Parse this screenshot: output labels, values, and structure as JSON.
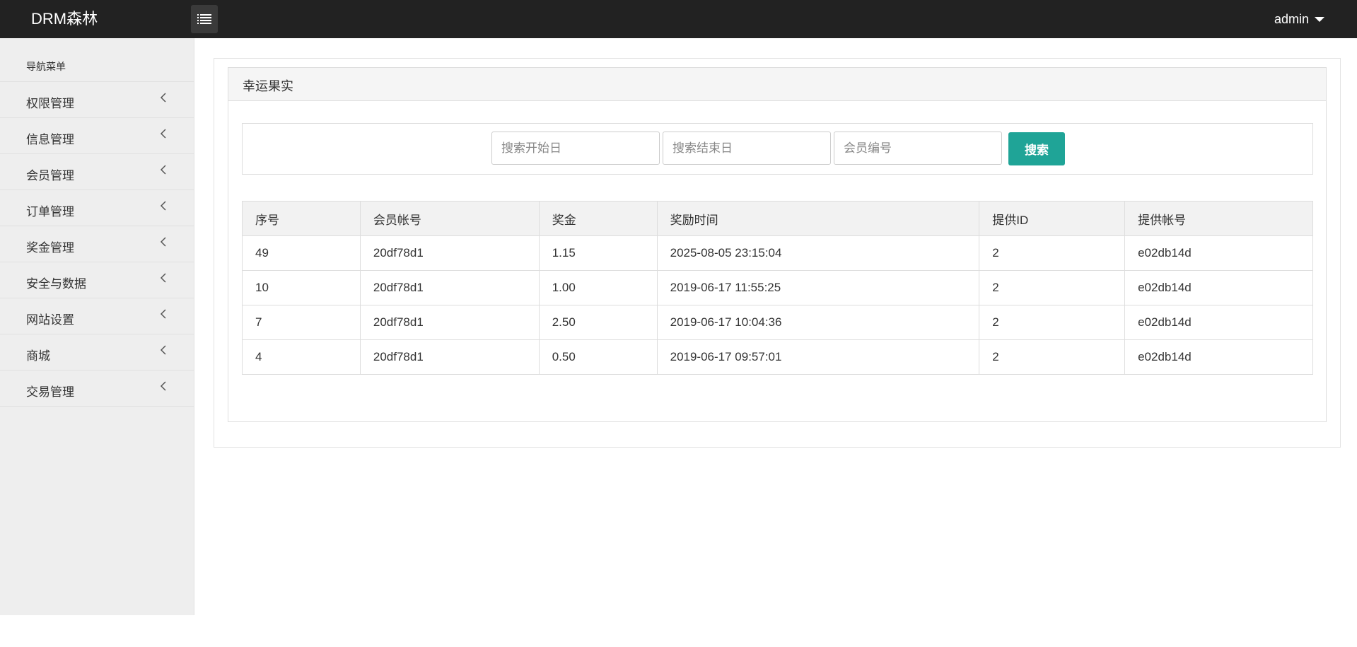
{
  "header": {
    "brand": "DRM森林",
    "user": "admin"
  },
  "sidebar": {
    "title": "导航菜单",
    "items": [
      {
        "label": "权限管理"
      },
      {
        "label": "信息管理"
      },
      {
        "label": "会员管理"
      },
      {
        "label": "订单管理"
      },
      {
        "label": "奖金管理"
      },
      {
        "label": "安全与数据"
      },
      {
        "label": "网站设置"
      },
      {
        "label": "商城"
      },
      {
        "label": "交易管理"
      }
    ]
  },
  "panel": {
    "title": "幸运果实"
  },
  "search": {
    "start_placeholder": "搜索开始日",
    "end_placeholder": "搜索结束日",
    "member_placeholder": "会员编号",
    "button_label": "搜索"
  },
  "table": {
    "headers": [
      "序号",
      "会员帐号",
      "奖金",
      "奖励时间",
      "提供ID",
      "提供帐号"
    ],
    "rows": [
      [
        "49",
        "20df78d1",
        "1.15",
        "2025-08-05 23:15:04",
        "2",
        "e02db14d"
      ],
      [
        "10",
        "20df78d1",
        "1.00",
        "2019-06-17 11:55:25",
        "2",
        "e02db14d"
      ],
      [
        "7",
        "20df78d1",
        "2.50",
        "2019-06-17 10:04:36",
        "2",
        "e02db14d"
      ],
      [
        "4",
        "20df78d1",
        "0.50",
        "2019-06-17 09:57:01",
        "2",
        "e02db14d"
      ]
    ]
  },
  "colors": {
    "topbar": "#222222",
    "sidebar": "#eeeeee",
    "accent_button": "#1fa497"
  }
}
